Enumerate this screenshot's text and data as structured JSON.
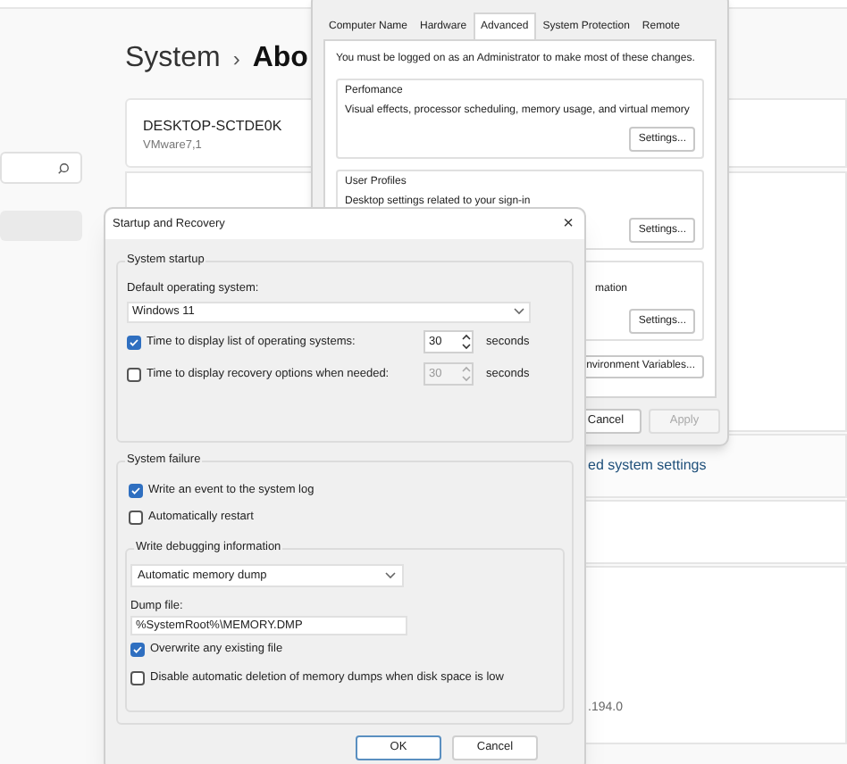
{
  "settings": {
    "breadcrumb_parent": "System",
    "breadcrumb_separator": "›",
    "breadcrumb_current": "Abo",
    "device_name": "DESKTOP-SCTDE0K",
    "device_model": "VMware7,1",
    "link_text": "ed system settings",
    "version": ".194.0"
  },
  "system_properties": {
    "tabs": [
      {
        "label": "Computer Name",
        "selected": false
      },
      {
        "label": "Hardware",
        "selected": false
      },
      {
        "label": "Advanced",
        "selected": true
      },
      {
        "label": "System Protection",
        "selected": false
      },
      {
        "label": "Remote",
        "selected": false
      }
    ],
    "note": "You must be logged on as an Administrator to make most of these changes.",
    "groups": [
      {
        "title": "Perfomance",
        "description": "Visual effects, processor scheduling, memory usage, and virtual memory",
        "button": "Settings..."
      },
      {
        "title": "User Profiles",
        "description": "Desktop settings related to your sign-in",
        "button": "Settings..."
      },
      {
        "description": "mation",
        "button": "Settings..."
      }
    ],
    "env_button": "nvironment Variables...",
    "buttons": [
      {
        "label": "Cancel",
        "disabled": false
      },
      {
        "label": "Apply",
        "disabled": true
      }
    ]
  },
  "dialog": {
    "title": "Startup and Recovery",
    "close": "×",
    "startup": {
      "title": "System startup",
      "default_os_label": "Default operating system:",
      "default_os": "Windows 11",
      "rows": [
        {
          "label": "Time to display list of operating systems:",
          "checked": true,
          "value": "30",
          "unit": "seconds"
        },
        {
          "label": "Time to display recovery options when needed:",
          "checked": false,
          "value": "30",
          "unit": "seconds"
        }
      ]
    },
    "failure": {
      "title": "System failure",
      "checks": [
        {
          "label": "Write an event to the system log",
          "checked": true
        },
        {
          "label": "Automatically restart",
          "checked": false
        }
      ],
      "debug": {
        "title": "Write debugging information",
        "type": "Automatic memory dump",
        "dump_label": "Dump file:",
        "dump_file": "%SystemRoot%\\MEMORY.DMP",
        "checks": [
          {
            "label": "Overwrite any existing file",
            "checked": true
          },
          {
            "label": "Disable automatic deletion of memory dumps when disk space is low",
            "checked": false
          }
        ]
      }
    },
    "buttons": [
      {
        "label": "OK",
        "primary": true
      },
      {
        "label": "Cancel",
        "primary": false
      }
    ]
  }
}
